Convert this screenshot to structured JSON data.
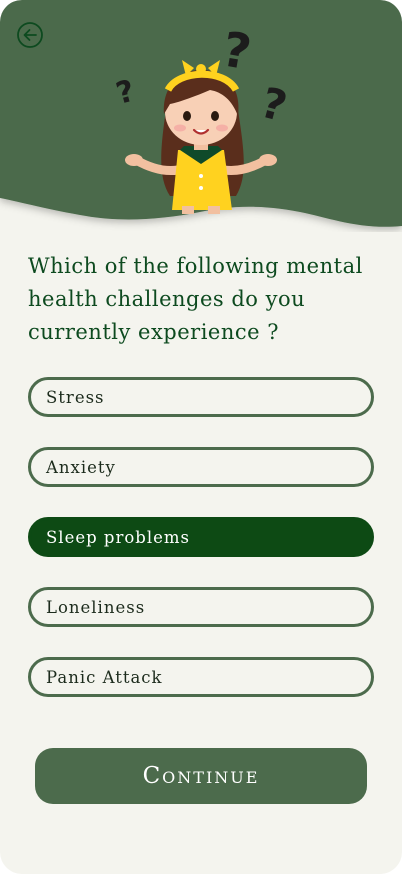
{
  "header": {
    "back_icon": "arrow-left-circle-icon",
    "illustration": "confused-girl-with-question-marks-illustration",
    "colors": {
      "background": "#4c6b4c",
      "back_icon": "#0d4a1f"
    }
  },
  "question": "Which of the following mental health challenges do you currently experience ?",
  "options": [
    {
      "label": "Stress",
      "selected": false
    },
    {
      "label": "Anxiety",
      "selected": false
    },
    {
      "label": "Sleep problems",
      "selected": true
    },
    {
      "label": "Loneliness",
      "selected": false
    },
    {
      "label": "Panic Attack",
      "selected": false
    }
  ],
  "continue_label": "Continue",
  "colors": {
    "page_background": "#f4f4ee",
    "option_border": "#4c6b4c",
    "option_selected": "#0d4a14",
    "question_text": "#0d4a1f",
    "button": "#4c6b4c"
  }
}
